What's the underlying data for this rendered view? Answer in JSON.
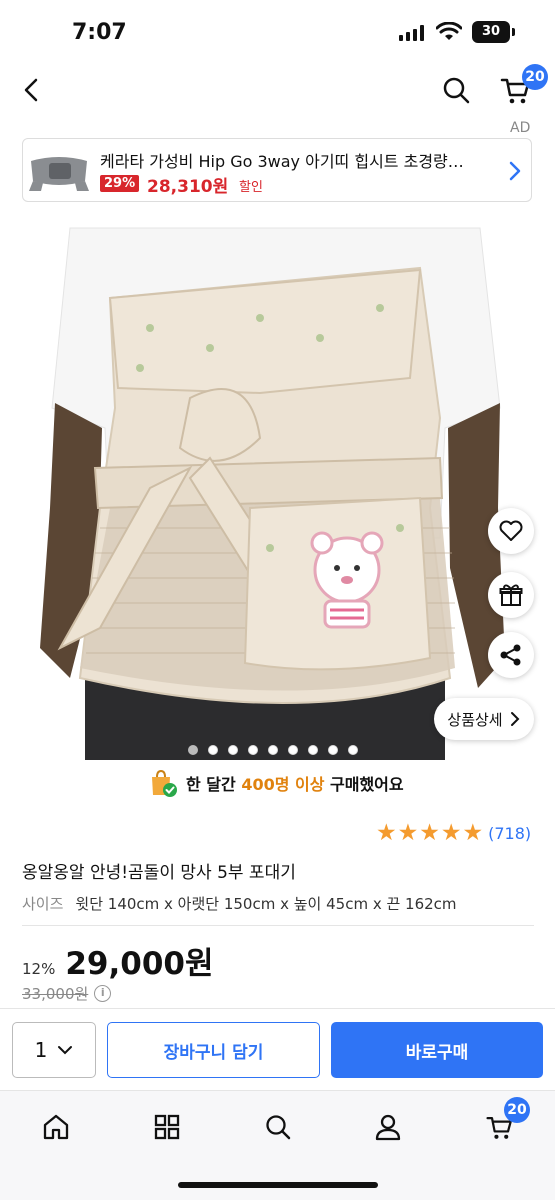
{
  "status_bar": {
    "time": "7:07",
    "battery": "30"
  },
  "header": {
    "cart_count": "20"
  },
  "ad": {
    "label": "AD",
    "title": "케라타 가성비 Hip Go 3way 아기띠 힙시트 초경량…",
    "discount": "29%",
    "price": "28,310원",
    "sale_label": "할인"
  },
  "image_actions": {
    "detail_label": "상품상세"
  },
  "gallery": {
    "total_dots": 9,
    "active_dot": 1
  },
  "purchase_note": {
    "prefix": "한 달간 ",
    "highlight": "400명 이상",
    "suffix": " 구매했어요"
  },
  "rating": {
    "stars": 5,
    "count": "(718)"
  },
  "product": {
    "title": "옹알옹알 안녕!곰돌이 망사 5부 포대기",
    "size_label": "사이즈",
    "size_value": "윗단 140cm x 아랫단 150cm x 높이 45cm x 끈 162cm",
    "discount_pct": "12%",
    "price": "29,000원",
    "original_price": "33,000원"
  },
  "buy_bar": {
    "quantity": "1",
    "cart_label": "장바구니 담기",
    "buy_label": "바로구매"
  },
  "tab_bar": {
    "cart_count": "20"
  },
  "colors": {
    "accent": "#2f74f5",
    "sale": "#d8262c",
    "star": "#f49b2f",
    "highlight": "#e0820e"
  }
}
